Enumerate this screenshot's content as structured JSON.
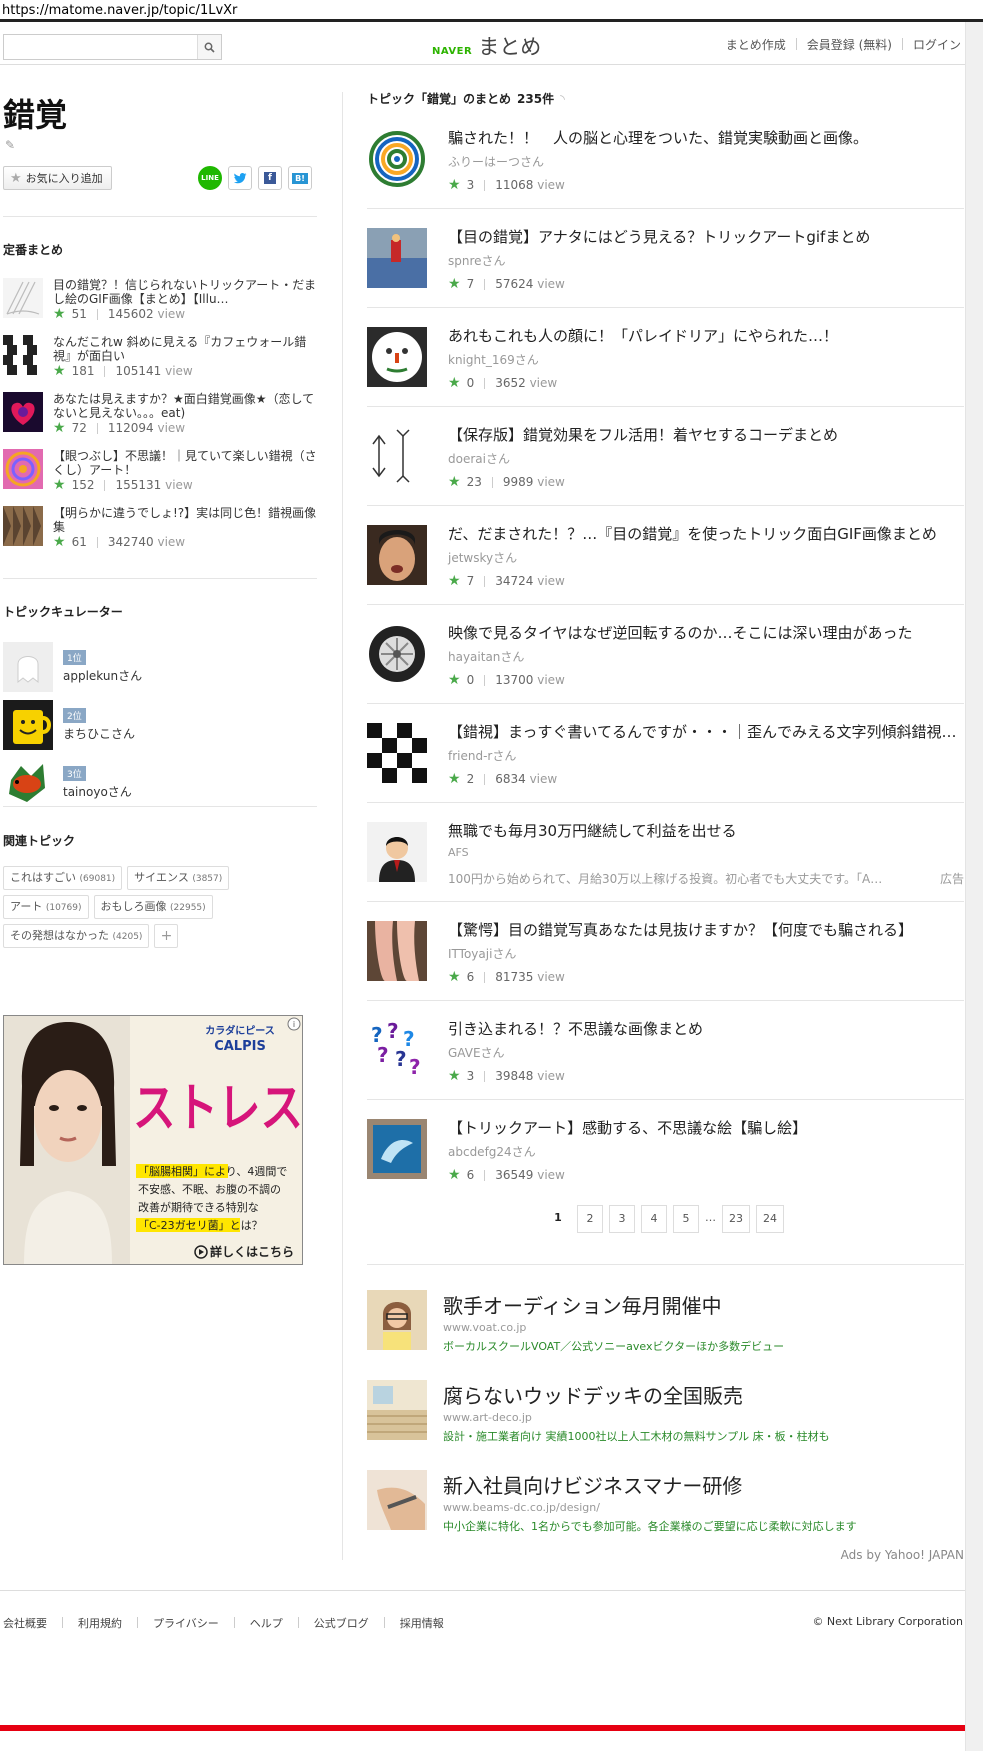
{
  "browser": {
    "url": "https://matome.naver.jp/topic/1LvXr"
  },
  "header": {
    "search_placeholder": "",
    "logo_brand": "NAVER",
    "logo_name": "まとめ",
    "nav": [
      "まとめ作成",
      "会員登録 (無料)",
      "ログイン"
    ]
  },
  "topic": {
    "title": "錯覚",
    "fav_label": "お気に入り追加",
    "share": {
      "line": "LINE",
      "twitter": "t",
      "facebook": "f",
      "hatena": "B!"
    }
  },
  "standard": {
    "heading": "定番まとめ",
    "items": [
      {
        "title": "目の錯覚？！信じられないトリックアート・だまし絵のGIF画像【まとめ】【Illu…",
        "stars": "51",
        "views": "145602",
        "view_label": "view"
      },
      {
        "title": "なんだこれw 斜めに見える『カフェウォール錯視』が面白い",
        "stars": "181",
        "views": "105141",
        "view_label": "view"
      },
      {
        "title": "あなたは見えますか？★面白錯覚画像★（恋してないと見えない。。。eat)",
        "stars": "72",
        "views": "112094",
        "view_label": "view"
      },
      {
        "title": "【眼つぶし】不思議！｜見ていて楽しい錯視（さくし）アート！",
        "stars": "152",
        "views": "155131",
        "view_label": "view"
      },
      {
        "title": "【明らかに違うでしょ!?】実は同じ色！錯視画像集",
        "stars": "61",
        "views": "342740",
        "view_label": "view"
      }
    ]
  },
  "curators": {
    "heading": "トピックキュレーター",
    "items": [
      {
        "rank": "1位",
        "name": "applekunさん"
      },
      {
        "rank": "2位",
        "name": "まちひこさん"
      },
      {
        "rank": "3位",
        "name": "tainoyoさん"
      }
    ]
  },
  "related": {
    "heading": "関連トピック",
    "tags": [
      {
        "name": "これはすごい",
        "count": "(69081)"
      },
      {
        "name": "サイエンス",
        "count": "(3857)"
      },
      {
        "name": "アート",
        "count": "(10769)"
      },
      {
        "name": "おもしろ画像",
        "count": "(22955)"
      },
      {
        "name": "その発想はなかった",
        "count": "(4205)"
      }
    ],
    "more": "+"
  },
  "side_ad": {
    "brand_top": "カラダにピース",
    "brand": "CALPIS",
    "headline": "ストレス",
    "body_1": "「脳腸相関」により、4週間で",
    "body_2": "不安感、不眠、お腹の不調の",
    "body_3": "改善が期待できる特別な",
    "body_4": "「C-23ガセリ菌」とは？",
    "cta": "詳しくはこちら",
    "info": "i"
  },
  "main": {
    "heading": "トピック「錯覚」のまとめ",
    "count": "235件",
    "items": [
      {
        "title": "騙された！！　人の脳と心理をついた、錯覚実験動画と画像。",
        "author": "ふりーはーつさん",
        "stars": "3",
        "views": "11068",
        "view_label": "view"
      },
      {
        "title": "【目の錯覚】アナタにはどう見える？トリックアートgifまとめ",
        "author": "spnreさん",
        "stars": "7",
        "views": "57624",
        "view_label": "view"
      },
      {
        "title": "あれもこれも人の顔に！「パレイドリア」にやられた…！",
        "author": "knight_169さん",
        "stars": "0",
        "views": "3652",
        "view_label": "view"
      },
      {
        "title": "【保存版】錯覚効果をフル活用！着ヤセするコーデまとめ",
        "author": "doeraiさん",
        "stars": "23",
        "views": "9989",
        "view_label": "view"
      },
      {
        "title": "だ、だまされた！？…『目の錯覚』を使ったトリック面白GIF画像まとめ",
        "author": "jetwskyさん",
        "stars": "7",
        "views": "34724",
        "view_label": "view"
      },
      {
        "title": "映像で見るタイヤはなぜ逆回転するのか…そこには深い理由があった",
        "author": "hayaitanさん",
        "stars": "0",
        "views": "13700",
        "view_label": "view"
      },
      {
        "title": "【錯視】まっすぐ書いてるんですが・・・｜歪んでみえる文字列傾斜錯視…",
        "author": "friend-rさん",
        "stars": "2",
        "views": "6834",
        "view_label": "view"
      },
      {
        "title": "【驚愕】目の錯覚写真あなたは見抜けますか？【何度でも騙される】",
        "author": "ITToyajiさん",
        "stars": "6",
        "views": "81735",
        "view_label": "view"
      },
      {
        "title": "引き込まれる！？不思議な画像まとめ",
        "author": "GAVEさん",
        "stars": "3",
        "views": "39848",
        "view_label": "view"
      },
      {
        "title": "【トリックアート】感動する、不思議な絵【騙し絵】",
        "author": "abcdefg24さん",
        "stars": "6",
        "views": "36549",
        "view_label": "view"
      }
    ],
    "sponsored": {
      "title": "無職でも毎月30万円継続して利益を出せる",
      "author": "AFS",
      "desc": "100円から始められて、月給30万以上稼げる投資。初心者でも大丈夫です。「A…",
      "badge": "広告"
    }
  },
  "pager": {
    "current": "1",
    "pages": [
      "2",
      "3",
      "4",
      "5"
    ],
    "dots": "…",
    "last_pages": [
      "23",
      "24"
    ]
  },
  "yahoo_ads": {
    "items": [
      {
        "title": "歌手オーディション毎月開催中",
        "url": "www.voat.co.jp",
        "desc": "ボーカルスクールVOAT／公式ソニーavexビクターほか多数デビュー"
      },
      {
        "title": "腐らないウッドデッキの全国販売",
        "url": "www.art-deco.jp",
        "desc": "設計・施工業者向け 実績1000社以上人工木材の無料サンプル 床・板・柱材も"
      },
      {
        "title": "新入社員向けビジネスマナー研修",
        "url": "www.beams-dc.co.jp/design/",
        "desc": "中小企業に特化、1名からでも参加可能。各企業様のご要望に応じ柔軟に対応します"
      }
    ],
    "label": "Ads by Yahoo! JAPAN"
  },
  "footer": {
    "links": [
      "会社概要",
      "利用規約",
      "プライバシー",
      "ヘルプ",
      "公式ブログ",
      "採用情報"
    ],
    "copyright": "© Next Library Corporation"
  },
  "bottom_banner": {
    "text": ""
  }
}
